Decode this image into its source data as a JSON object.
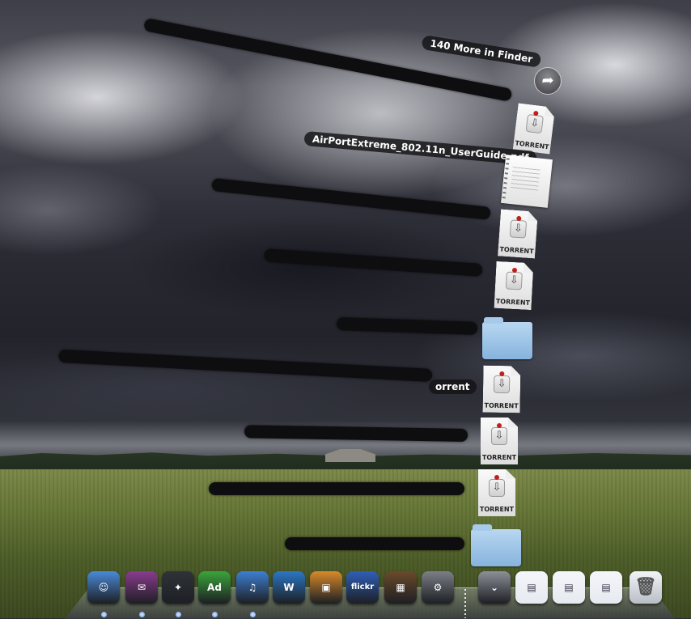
{
  "stack": {
    "more_label": "140 More in Finder",
    "more_button_icon": "arrow-right-circle-icon",
    "torrent_caption": "TORRENT",
    "pdf_label": "AirPortExtreme_802.11n_UserGuide.pdf",
    "partial_torrent_label": "orrent",
    "folder_icon": "folder-icon",
    "torrent_icon": "torrent-document-icon",
    "pdf_icon": "pdf-document-icon"
  },
  "dock": {
    "apps": [
      {
        "name": "Finder",
        "icon": "finder-icon",
        "glyph": "☺",
        "color": "#4a8ad8",
        "running": true
      },
      {
        "name": "Apple Mail",
        "icon": "mail-stamp-icon",
        "glyph": "✉",
        "color": "#8a3b8e",
        "running": true
      },
      {
        "name": "Network Utility",
        "icon": "compass-icon",
        "glyph": "✦",
        "color": "#2f3338",
        "running": true
      },
      {
        "name": "Adium",
        "icon": "adium-icon",
        "glyph": "Ad",
        "color": "#3aa53a",
        "running": true
      },
      {
        "name": "iTunes",
        "icon": "itunes-icon",
        "glyph": "♫",
        "color": "#3d7fd1",
        "running": true
      },
      {
        "name": "Writer",
        "icon": "writer-icon",
        "glyph": "W",
        "color": "#2b77c5",
        "running": false
      },
      {
        "name": "iPhoto",
        "icon": "iphoto-icon",
        "glyph": "▣",
        "color": "#d88a2a",
        "running": false
      },
      {
        "name": "Flickr Uploadr",
        "icon": "flickr-upload-icon",
        "glyph": "flickr",
        "color": "#2f5fb8",
        "running": false
      },
      {
        "name": "Package",
        "icon": "package-icon",
        "glyph": "▦",
        "color": "#6b4a2a",
        "running": false
      },
      {
        "name": "System Preferences",
        "icon": "gear-icon",
        "glyph": "⚙",
        "color": "#7c7f86",
        "running": false
      }
    ],
    "docs": [
      {
        "name": "Downloads stack",
        "icon": "downloads-stack-icon",
        "glyph": "⌄",
        "color": "#8d9097",
        "running": false
      },
      {
        "name": "Window 1",
        "icon": "window-thumbnail-icon",
        "glyph": "▤",
        "color": "#e6e9ef",
        "running": false
      },
      {
        "name": "Window 2",
        "icon": "window-thumbnail-icon",
        "glyph": "▤",
        "color": "#e6e9ef",
        "running": false
      },
      {
        "name": "Window 3",
        "icon": "window-thumbnail-icon",
        "glyph": "▤",
        "color": "#e6e9ef",
        "running": false
      }
    ],
    "trash_icon": "trash-icon"
  }
}
